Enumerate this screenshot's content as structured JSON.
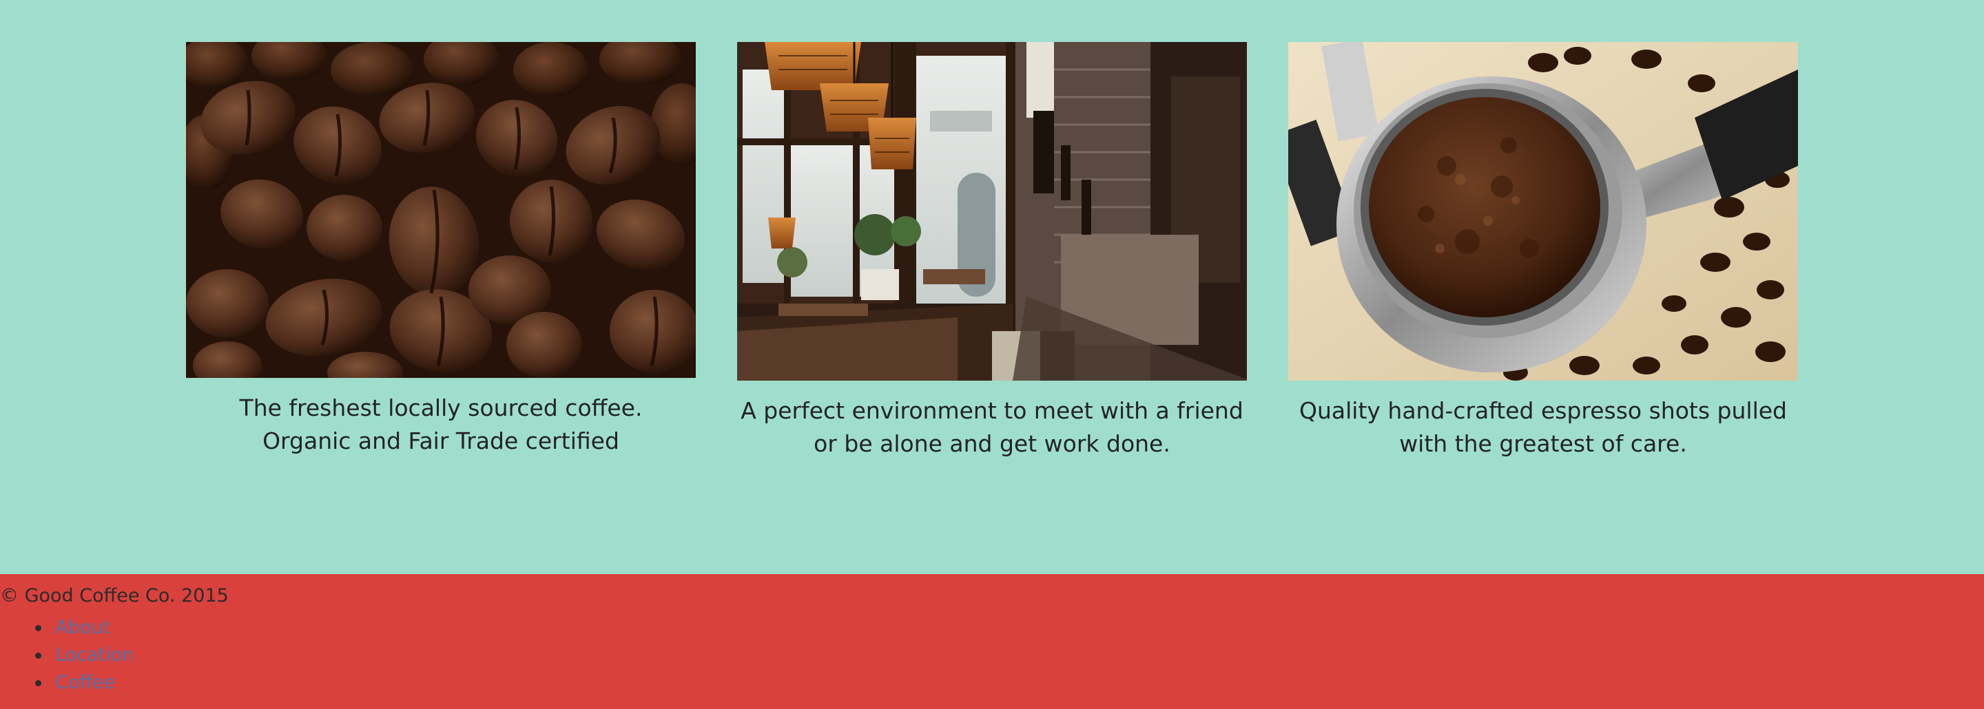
{
  "features": [
    {
      "image": "coffee-beans-photo",
      "caption": "The freshest locally sourced coffee. Organic and Fair Trade certified"
    },
    {
      "image": "cafe-interior-photo",
      "caption": "A perfect environment to meet with a friend or be alone and get work done."
    },
    {
      "image": "espresso-portafilter-photo",
      "caption": "Quality hand-crafted espresso shots pulled with the greatest of care."
    }
  ],
  "footer": {
    "copyright": "© Good Coffee Co. 2015",
    "links": [
      {
        "label": "About"
      },
      {
        "label": "Location"
      },
      {
        "label": "Coffee"
      }
    ]
  },
  "colors": {
    "page_background": "#9fdecd",
    "footer_background": "#d9413c",
    "link_color": "#5a6fa6",
    "text_color": "#232323"
  }
}
